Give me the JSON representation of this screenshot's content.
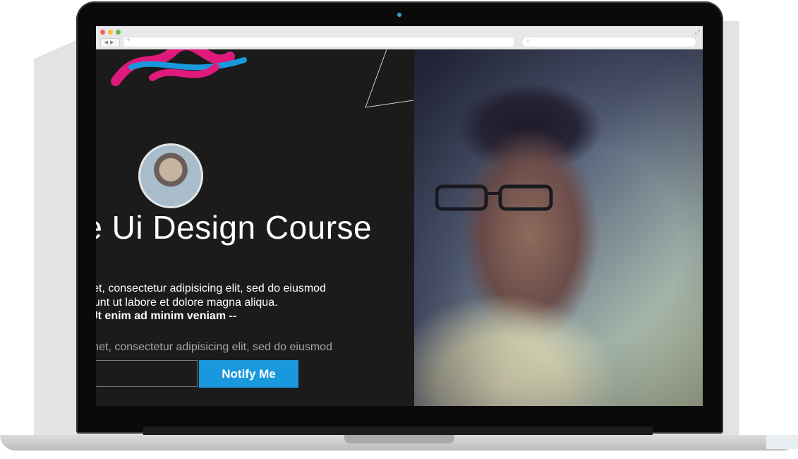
{
  "page": {
    "title": "te Ui Design Course",
    "description_line1": "t amet, consectetur adipisicing elit, sed do eiusmod",
    "description_line2": "cididunt ut labore et dolore magna aliqua.",
    "quote": "-- Ut enim ad minim veniam --",
    "subtext": "t amet, consectetur adipisicing elit, sed do eiusmod",
    "email_value": "",
    "notify_label": "Notify Me"
  },
  "colors": {
    "accent": "#1a98de",
    "background": "#1b1b1b"
  },
  "icons": {
    "nav": "back-forward-icon",
    "search": "search-icon",
    "expand": "expand-icon",
    "new_tab": "plus-icon"
  }
}
